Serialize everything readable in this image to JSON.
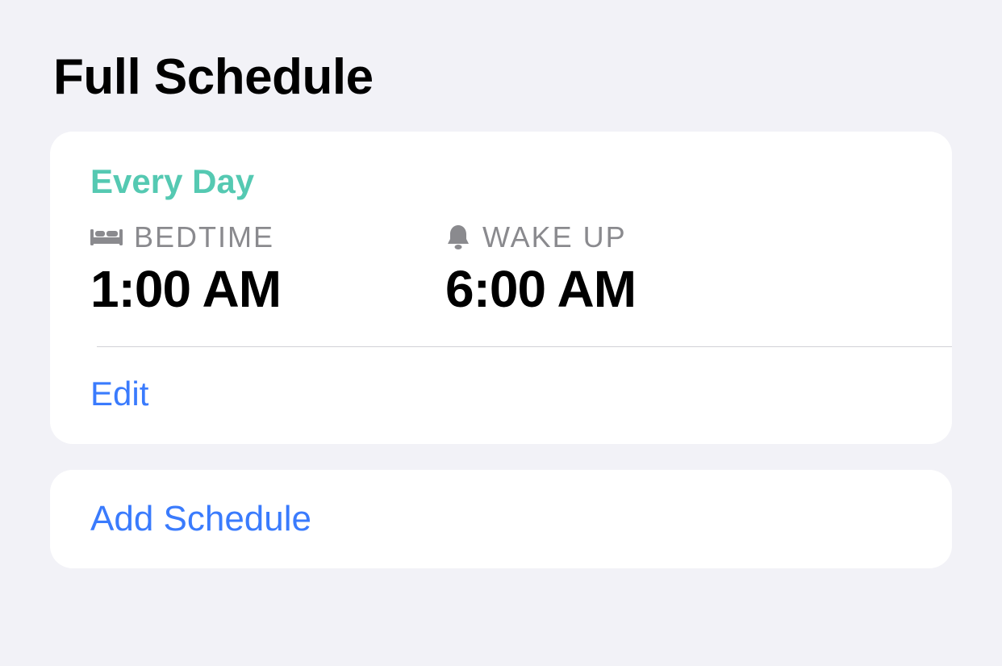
{
  "page": {
    "title": "Full Schedule"
  },
  "schedule": {
    "days_label": "Every Day",
    "bedtime": {
      "label": "BEDTIME",
      "time": "1:00 AM"
    },
    "wakeup": {
      "label": "WAKE UP",
      "time": "6:00 AM"
    },
    "edit_label": "Edit"
  },
  "add_schedule_label": "Add Schedule"
}
